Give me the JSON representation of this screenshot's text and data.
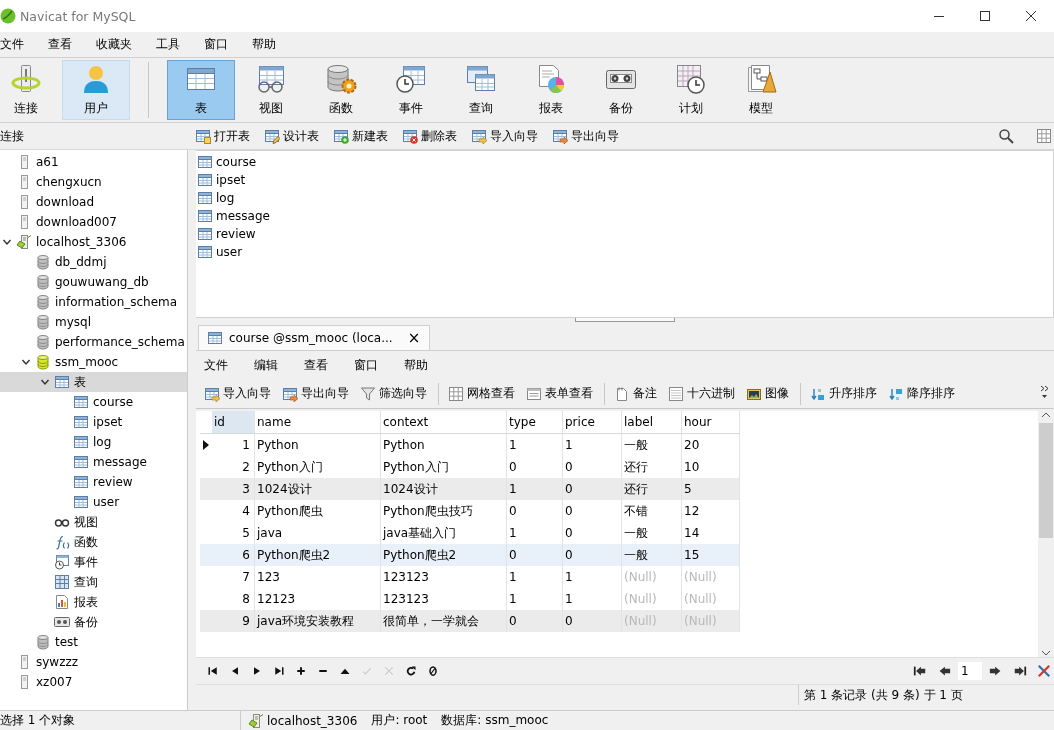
{
  "window": {
    "title": "Navicat for MySQL"
  },
  "menu": [
    "文件",
    "查看",
    "收藏夹",
    "工具",
    "窗口",
    "帮助"
  ],
  "main_toolbar": [
    {
      "label": "连接",
      "kind": "server",
      "selected": false,
      "hovered": false,
      "separator_before": false
    },
    {
      "label": "用户",
      "kind": "user",
      "selected": false,
      "hovered": true,
      "separator_before": false
    },
    {
      "label": "表",
      "kind": "table",
      "selected": true,
      "hovered": false,
      "separator_before": true
    },
    {
      "label": "视图",
      "kind": "view",
      "selected": false,
      "hovered": false,
      "separator_before": false
    },
    {
      "label": "函数",
      "kind": "function",
      "selected": false,
      "hovered": false,
      "separator_before": false
    },
    {
      "label": "事件",
      "kind": "event",
      "selected": false,
      "hovered": false,
      "separator_before": false
    },
    {
      "label": "查询",
      "kind": "query",
      "selected": false,
      "hovered": false,
      "separator_before": false
    },
    {
      "label": "报表",
      "kind": "report",
      "selected": false,
      "hovered": false,
      "separator_before": false
    },
    {
      "label": "备份",
      "kind": "backup",
      "selected": false,
      "hovered": false,
      "separator_before": false
    },
    {
      "label": "计划",
      "kind": "schedule",
      "selected": false,
      "hovered": false,
      "separator_before": false
    },
    {
      "label": "模型",
      "kind": "model",
      "selected": false,
      "hovered": false,
      "separator_before": false
    }
  ],
  "sidebar": {
    "header": "连接",
    "items": [
      {
        "name": "a61",
        "kind": "server",
        "selected": false
      },
      {
        "name": "chengxucn",
        "kind": "server",
        "selected": false
      },
      {
        "name": "download",
        "kind": "server",
        "selected": false
      },
      {
        "name": "download007",
        "kind": "server",
        "selected": false
      },
      {
        "name": "localhost_3306",
        "kind": "server",
        "selected": false,
        "expanded": true,
        "children": [
          {
            "name": "db_ddmj",
            "kind": "database",
            "selected": false
          },
          {
            "name": "gouwuwang_db",
            "kind": "database",
            "selected": false
          },
          {
            "name": "information_schema",
            "kind": "database",
            "selected": false
          },
          {
            "name": "mysql",
            "kind": "database",
            "selected": false
          },
          {
            "name": "performance_schema",
            "kind": "database",
            "selected": false
          },
          {
            "name": "ssm_mooc",
            "kind": "database",
            "selected": false,
            "expanded": true,
            "children": [
              {
                "name": "表",
                "kind": "tables",
                "selected": true,
                "expanded": true,
                "children": [
                  {
                    "name": "course",
                    "kind": "table",
                    "selected": false
                  },
                  {
                    "name": "ipset",
                    "kind": "table",
                    "selected": false
                  },
                  {
                    "name": "log",
                    "kind": "table",
                    "selected": false
                  },
                  {
                    "name": "message",
                    "kind": "table",
                    "selected": false
                  },
                  {
                    "name": "review",
                    "kind": "table",
                    "selected": false
                  },
                  {
                    "name": "user",
                    "kind": "table",
                    "selected": false
                  }
                ]
              },
              {
                "name": "视图",
                "kind": "views",
                "selected": false
              },
              {
                "name": "函数",
                "kind": "functions",
                "selected": false
              },
              {
                "name": "事件",
                "kind": "events",
                "selected": false
              },
              {
                "name": "查询",
                "kind": "queries",
                "selected": false
              },
              {
                "name": "报表",
                "kind": "reports",
                "selected": false
              },
              {
                "name": "备份",
                "kind": "backups",
                "selected": false
              }
            ]
          },
          {
            "name": "test",
            "kind": "database",
            "selected": false
          }
        ]
      },
      {
        "name": "sywzzz",
        "kind": "server",
        "selected": false
      },
      {
        "name": "xz007",
        "kind": "server",
        "selected": false
      }
    ]
  },
  "object_toolbar": [
    {
      "label": "打开表",
      "kind": "open-table"
    },
    {
      "label": "设计表",
      "kind": "design-table"
    },
    {
      "label": "新建表",
      "kind": "new-table"
    },
    {
      "label": "删除表",
      "kind": "delete-table"
    },
    {
      "label": "导入向导",
      "kind": "import"
    },
    {
      "label": "导出向导",
      "kind": "export"
    }
  ],
  "objects": [
    "course",
    "ipset",
    "log",
    "message",
    "review",
    "user"
  ],
  "editor": {
    "tab": {
      "title": "course @ssm_mooc (loca...",
      "close": "×",
      "selected": true
    },
    "menu": [
      "文件",
      "编辑",
      "查看",
      "窗口",
      "帮助"
    ],
    "toolbar": [
      {
        "label": "导入向导",
        "kind": "import",
        "separator_before": false
      },
      {
        "label": "导出向导",
        "kind": "export",
        "separator_before": false
      },
      {
        "label": "筛选向导",
        "kind": "filter",
        "separator_before": false
      },
      {
        "label": "网格查看",
        "kind": "grid",
        "separator_before": true
      },
      {
        "label": "表单查看",
        "kind": "form",
        "separator_before": false
      },
      {
        "label": "备注",
        "kind": "memo",
        "separator_before": true
      },
      {
        "label": "十六进制",
        "kind": "hex",
        "separator_before": false
      },
      {
        "label": "图像",
        "kind": "image",
        "separator_before": false
      },
      {
        "label": "升序排序",
        "kind": "sort-asc",
        "separator_before": true
      },
      {
        "label": "降序排序",
        "kind": "sort-desc",
        "separator_before": false
      }
    ],
    "table": {
      "columns": [
        {
          "label": "id",
          "selected": true
        },
        {
          "label": "name",
          "selected": false
        },
        {
          "label": "context",
          "selected": false
        },
        {
          "label": "type",
          "selected": false
        },
        {
          "label": "price",
          "selected": false
        },
        {
          "label": "label",
          "selected": false
        },
        {
          "label": "hour",
          "selected": false
        }
      ],
      "rows": [
        {
          "cells": [
            "1",
            "Python",
            "Python",
            "1",
            "1",
            "一般",
            "20"
          ],
          "null": [
            false,
            false,
            false,
            false,
            false,
            false,
            false
          ],
          "selected": true,
          "striped": false,
          "hovered": false
        },
        {
          "cells": [
            "2",
            "Python入门",
            "Python入门",
            "0",
            "0",
            "还行",
            "10"
          ],
          "null": [
            false,
            false,
            false,
            false,
            false,
            false,
            false
          ],
          "selected": false,
          "striped": false,
          "hovered": false
        },
        {
          "cells": [
            "3",
            "1024设计",
            "1024设计",
            "1",
            "0",
            "还行",
            "5"
          ],
          "null": [
            false,
            false,
            false,
            false,
            false,
            false,
            false
          ],
          "selected": false,
          "striped": true,
          "hovered": false
        },
        {
          "cells": [
            "4",
            "Python爬虫",
            "Python爬虫技巧",
            "0",
            "0",
            "不错",
            "12"
          ],
          "null": [
            false,
            false,
            false,
            false,
            false,
            false,
            false
          ],
          "selected": false,
          "striped": false,
          "hovered": false
        },
        {
          "cells": [
            "5",
            "java",
            "java基础入门",
            "1",
            "0",
            "一般",
            "14"
          ],
          "null": [
            false,
            false,
            false,
            false,
            false,
            false,
            false
          ],
          "selected": false,
          "striped": false,
          "hovered": false
        },
        {
          "cells": [
            "6",
            "Python爬虫2",
            "Python爬虫2",
            "0",
            "0",
            "一般",
            "15"
          ],
          "null": [
            false,
            false,
            false,
            false,
            false,
            false,
            false
          ],
          "selected": false,
          "striped": false,
          "hovered": true
        },
        {
          "cells": [
            "7",
            "123",
            "123123",
            "1",
            "1",
            "(Null)",
            "(Null)"
          ],
          "null": [
            false,
            false,
            false,
            false,
            false,
            true,
            true
          ],
          "selected": false,
          "striped": false,
          "hovered": false
        },
        {
          "cells": [
            "8",
            "12123",
            "123123",
            "1",
            "1",
            "(Null)",
            "(Null)"
          ],
          "null": [
            false,
            false,
            false,
            false,
            false,
            true,
            true
          ],
          "selected": false,
          "striped": false,
          "hovered": false
        },
        {
          "cells": [
            "9",
            "java环境安装教程",
            "很简单，一学就会",
            "0",
            "0",
            "(Null)",
            "(Null)"
          ],
          "null": [
            false,
            false,
            false,
            false,
            false,
            true,
            true
          ],
          "selected": false,
          "striped": true,
          "hovered": false
        }
      ]
    },
    "nav_buttons": [
      {
        "kind": "first",
        "disabled": false
      },
      {
        "kind": "prev",
        "disabled": false
      },
      {
        "kind": "next",
        "disabled": false
      },
      {
        "kind": "last",
        "disabled": false
      },
      {
        "kind": "add",
        "disabled": false
      },
      {
        "kind": "remove",
        "disabled": false
      },
      {
        "kind": "up",
        "disabled": false
      },
      {
        "kind": "apply",
        "disabled": true
      },
      {
        "kind": "cancel",
        "disabled": true
      },
      {
        "kind": "refresh",
        "disabled": false
      },
      {
        "kind": "stop",
        "disabled": false
      }
    ],
    "pager": {
      "page": "1"
    },
    "record_status": "第 1 条记录 (共 9 条) 于 1 页"
  },
  "status_bar": {
    "selection": "选择 1 个对象",
    "connection": "localhost_3306",
    "user": "用户: root",
    "database": "数据库: ssm_mooc"
  }
}
